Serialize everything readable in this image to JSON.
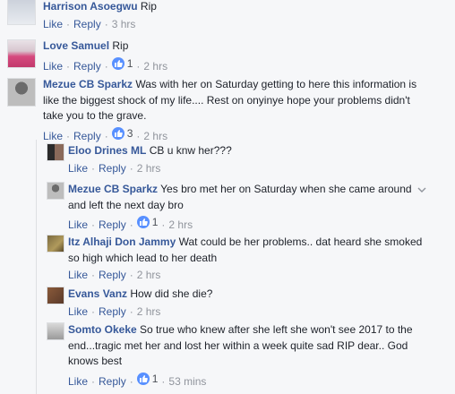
{
  "colors": {
    "link": "#365899",
    "muted": "#90949c",
    "text": "#1d2129",
    "like_blue": "#5890ff"
  },
  "comments": [
    {
      "name": "Harrison Asoegwu",
      "text": "Rip",
      "actions": {
        "like": "Like",
        "reply": "Reply",
        "likes": "",
        "time": "3 hrs"
      }
    },
    {
      "name": "Love Samuel",
      "text": "Rip",
      "actions": {
        "like": "Like",
        "reply": "Reply",
        "likes": "1",
        "time": "2 hrs"
      }
    },
    {
      "name": "Mezue CB Sparkz",
      "text": "Was with her on Saturday getting to here this information is like the biggest shock of my life.... Rest on onyinye hope your problems didn't take you to the grave.",
      "actions": {
        "like": "Like",
        "reply": "Reply",
        "likes": "3",
        "time": "2 hrs"
      }
    }
  ],
  "replies": [
    {
      "name": "Eloo Drines ML",
      "text": "CB u knw her???",
      "actions": {
        "like": "Like",
        "reply": "Reply",
        "time": "2 hrs"
      }
    },
    {
      "name": "Mezue CB Sparkz",
      "text": "Yes bro met her on Saturday when she came around and left the next day bro",
      "actions": {
        "like": "Like",
        "reply": "Reply",
        "likes": "1",
        "time": "2 hrs"
      }
    },
    {
      "name": "Itz Alhaji Don Jammy",
      "text": "Wat could be her problems.. dat heard she smoked so high which lead to her death",
      "actions": {
        "like": "Like",
        "reply": "Reply",
        "time": "2 hrs"
      }
    },
    {
      "name": "Evans Vanz",
      "text": "How did she die?",
      "actions": {
        "like": "Like",
        "reply": "Reply",
        "time": "2 hrs"
      }
    },
    {
      "name": "Somto Okeke",
      "text": "So true who knew after she left she won't see 2017 to the end...tragic met her and lost her within a week quite sad RIP dear.. God knows best",
      "actions": {
        "like": "Like",
        "reply": "Reply",
        "likes": "1",
        "time": "53 mins"
      }
    }
  ],
  "icons": {
    "like_count": "thumbs-up-icon",
    "options": "chevron-down-icon"
  }
}
